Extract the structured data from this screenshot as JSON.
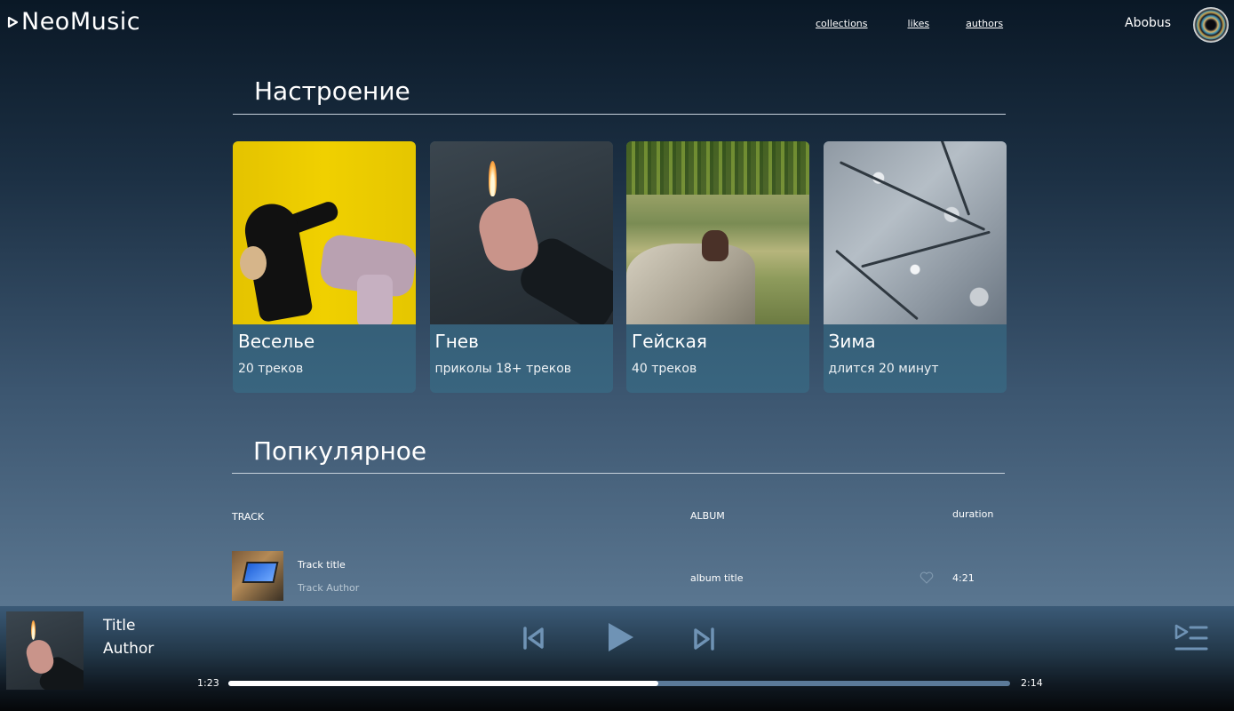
{
  "app": {
    "name": "NeoMusic",
    "logo_icon": "play-triangle-icon"
  },
  "nav": {
    "items": [
      {
        "label": "collections"
      },
      {
        "label": "likes"
      },
      {
        "label": "authors"
      }
    ]
  },
  "user": {
    "name": "Abobus",
    "avatar_icon": "avatar-circle"
  },
  "mood": {
    "title": "Настроение",
    "cards": [
      {
        "title": "Веселье",
        "subtitle": "20 треков"
      },
      {
        "title": "Гнев",
        "subtitle": "приколы 18+ треков"
      },
      {
        "title": "Гейская",
        "subtitle": "40 треков"
      },
      {
        "title": "Зима",
        "subtitle": "длится 20 минут"
      }
    ]
  },
  "popular": {
    "title": "Попкулярное",
    "columns": {
      "track": "TRACK",
      "album": "ALBUM",
      "duration": "duration"
    },
    "rows": [
      {
        "title": "Track title",
        "author": "Track Author",
        "album": "album title",
        "duration": "4:21",
        "liked": false
      }
    ]
  },
  "player": {
    "title": "Title",
    "author": "Author",
    "current_time": "1:23",
    "total_time": "2:14",
    "progress": 0.55,
    "controls": [
      "skip-previous-icon",
      "play-icon",
      "skip-next-icon",
      "queue-list-icon"
    ]
  },
  "colors": {
    "card_bg": "#39657f",
    "progress_track": "#5b7a99",
    "progress_fill": "#ffffff",
    "control_icon": "#6f93b5"
  }
}
